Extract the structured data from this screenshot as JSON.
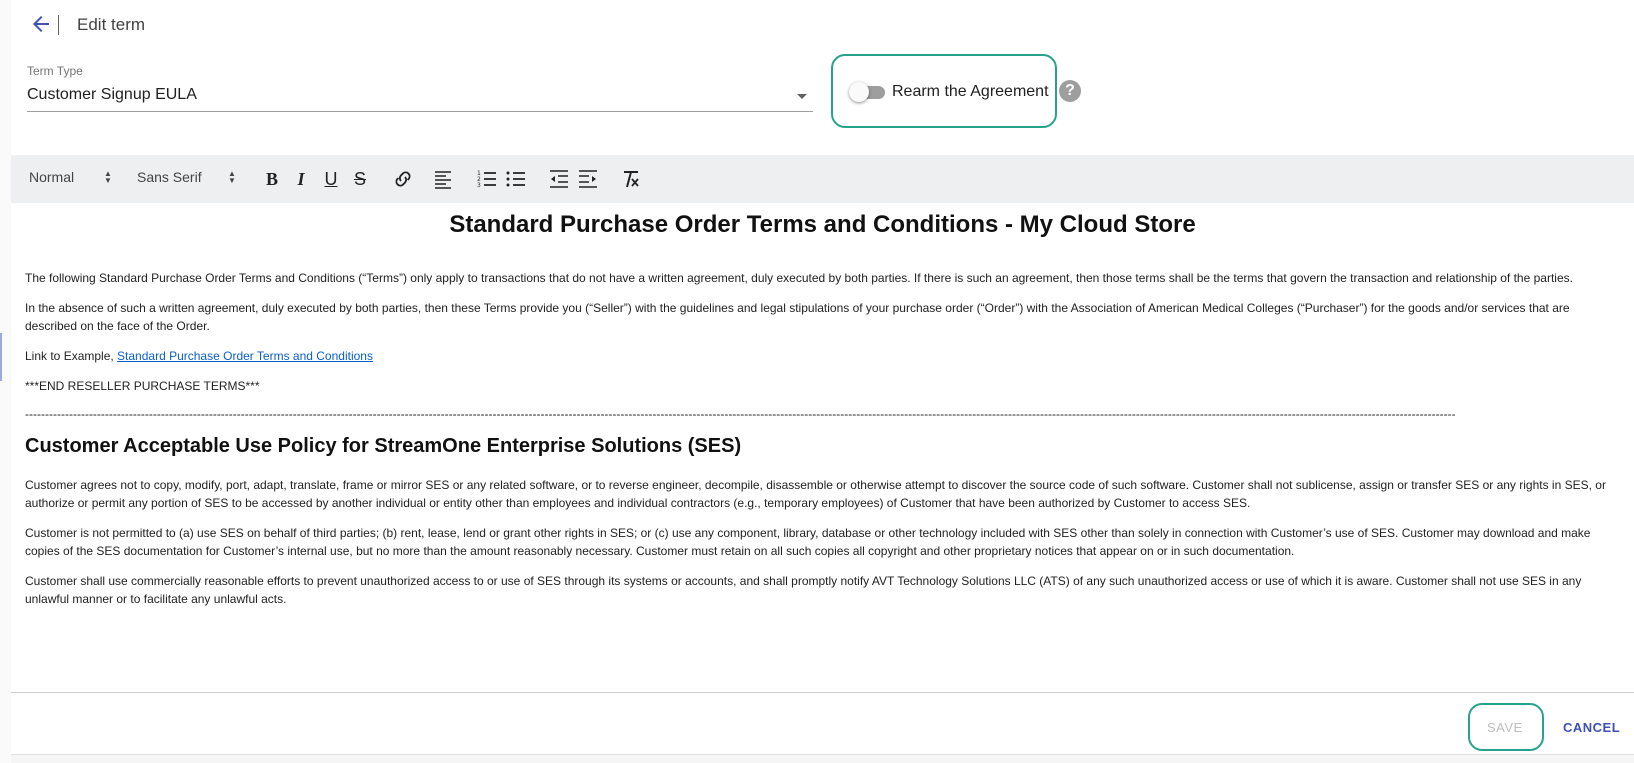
{
  "header": {
    "back_icon": "arrow-left-icon",
    "title": "Edit term"
  },
  "term_type": {
    "label": "Term Type",
    "value": "Customer Signup EULA"
  },
  "rearm": {
    "label": "Rearm the Agreement",
    "enabled": false,
    "help_icon": "help-circle-icon",
    "help_glyph": "?"
  },
  "toolbar": {
    "size_select": "Normal",
    "font_select": "Sans Serif",
    "bold": "B",
    "italic": "I",
    "underline": "U",
    "strike": "S",
    "tools": [
      "bold-icon",
      "italic-icon",
      "underline-icon",
      "strikethrough-icon",
      "link-icon",
      "align-left-icon",
      "ordered-list-icon",
      "bullet-list-icon",
      "outdent-icon",
      "indent-icon",
      "clear-format-icon"
    ]
  },
  "editor": {
    "heading": "Standard Purchase Order Terms and Conditions - My Cloud Store",
    "p1": "The following Standard Purchase Order Terms and Conditions (“Terms”) only apply to transactions that do not have a written agreement, duly executed by both parties. If there is such an agreement, then those terms shall be the terms that govern the transaction and relationship of the parties.",
    "p2": "In the absence of such a written agreement, duly executed by both parties, then these Terms provide you (“Seller”) with the guidelines and legal stipulations of your purchase order (“Order”) with the Association of American Medical Colleges (“Purchaser”) for the goods and/or services that are described on the face of the Order.",
    "link_prefix": "Link to Example, ",
    "link_text": "Standard Purchase Order Terms and Conditions",
    "end_marker": "***END RESELLER PURCHASE TERMS***",
    "separator": "----------------------------------------------------------------------------------------------------------------------------------------------------------------------------------------------------------------------------------------------------------------------------------------------------------------------------------------------------------------------",
    "heading2": "Customer Acceptable Use Policy for StreamOne Enterprise Solutions (SES)",
    "p3": "Customer agrees not to copy, modify, port, adapt, translate, frame or mirror SES or any related software, or to reverse engineer, decompile, disassemble or otherwise attempt to discover the source code of such software. Customer shall not sublicense, assign or transfer SES or any rights in SES, or authorize or permit any portion of SES to be accessed by another individual or entity other than employees and individual contractors (e.g., temporary employees) of Customer that have been authorized by Customer to access SES.",
    "p4": "Customer is not permitted to (a) use SES on behalf of third parties; (b) rent, lease, lend or grant other rights in SES; or (c) use any component, library, database or other technology included with SES other than solely in connection with Customer’s use of SES. Customer may download and make copies of the SES documentation for Customer’s internal use, but no more than the amount reasonably necessary. Customer must retain on all such copies all copyright and other proprietary notices that appear on or in such documentation.",
    "p5": "Customer shall use commercially reasonable efforts to prevent unauthorized access to or use of SES through its systems or accounts, and shall promptly notify AVT Technology Solutions LLC (ATS) of any such unauthorized access or use of which it is aware. Customer shall not use SES in any unlawful manner or to facilitate any unlawful acts."
  },
  "footer": {
    "save_label": "SAVE",
    "cancel_label": "CANCEL"
  },
  "colors": {
    "accent": "#3f51b5",
    "highlight": "#26a38c",
    "link": "#0b5fc7"
  }
}
